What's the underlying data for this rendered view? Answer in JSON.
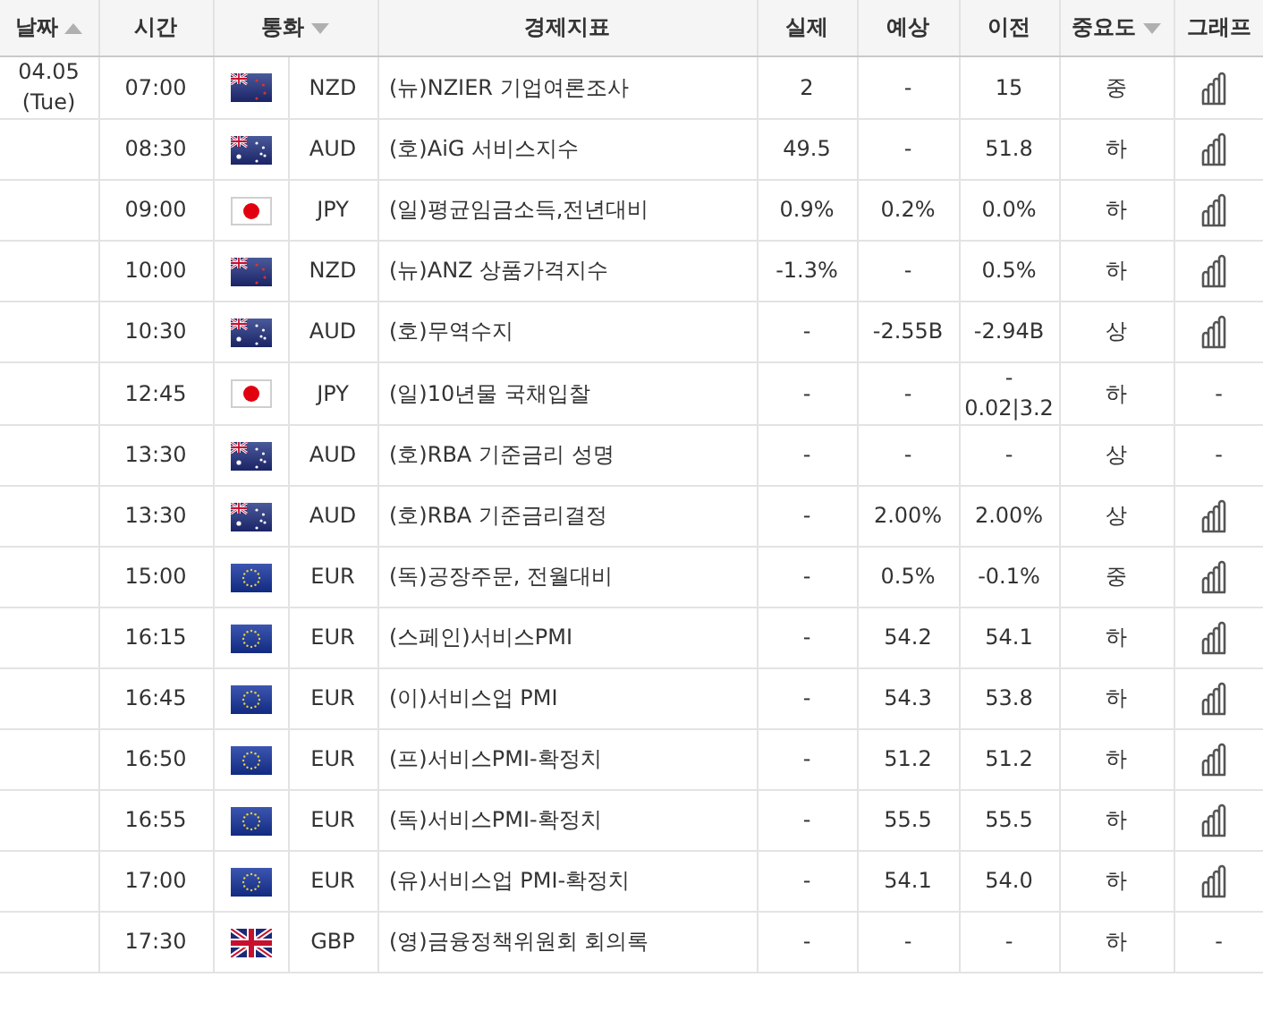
{
  "columns": [
    {
      "label": "날짜",
      "kind": "sort_asc"
    },
    {
      "label": "시간",
      "kind": "plain"
    },
    {
      "label": "통화",
      "kind": "sort_desc"
    },
    {
      "label": "경제지표",
      "kind": "plain"
    },
    {
      "label": "실제",
      "kind": "plain"
    },
    {
      "label": "예상",
      "kind": "plain"
    },
    {
      "label": "이전",
      "kind": "plain"
    },
    {
      "label": "중요도",
      "kind": "sort_desc"
    },
    {
      "label": "그래프",
      "kind": "plain"
    }
  ],
  "rows": [
    {
      "date": "04.05",
      "weekday": "(Tue)",
      "time": "07:00",
      "flag": {
        "kind": "nz"
      },
      "currency": "NZD",
      "indicator": "(뉴)NZIER 기업여론조사",
      "actual": "2",
      "forecast": "-",
      "previous": "15",
      "importance": "중",
      "graph": {
        "kind": "chart"
      }
    },
    {
      "time": "08:30",
      "flag": {
        "kind": "au"
      },
      "currency": "AUD",
      "indicator": "(호)AiG 서비스지수",
      "actual": "49.5",
      "forecast": "-",
      "previous": "51.8",
      "importance": "하",
      "graph": {
        "kind": "chart"
      }
    },
    {
      "time": "09:00",
      "flag": {
        "kind": "jp"
      },
      "currency": "JPY",
      "indicator": "(일)평균임금소득,전년대비",
      "actual": "0.9%",
      "forecast": "0.2%",
      "previous": "0.0%",
      "importance": "하",
      "graph": {
        "kind": "chart"
      }
    },
    {
      "time": "10:00",
      "flag": {
        "kind": "nz"
      },
      "currency": "NZD",
      "indicator": "(뉴)ANZ 상품가격지수",
      "actual": "-1.3%",
      "forecast": "-",
      "previous": "0.5%",
      "importance": "하",
      "graph": {
        "kind": "chart"
      }
    },
    {
      "time": "10:30",
      "flag": {
        "kind": "au"
      },
      "currency": "AUD",
      "indicator": "(호)무역수지",
      "actual": "-",
      "forecast": "-2.55B",
      "previous": "-2.94B",
      "importance": "상",
      "graph": {
        "kind": "chart"
      }
    },
    {
      "time": "12:45",
      "flag": {
        "kind": "jp"
      },
      "currency": "JPY",
      "indicator": "(일)10년물 국채입찰",
      "actual": "-",
      "forecast": "-",
      "previous": "-\n0.02|3.2",
      "importance": "하",
      "graph": {
        "kind": "text",
        "text": "-"
      }
    },
    {
      "time": "13:30",
      "flag": {
        "kind": "au"
      },
      "currency": "AUD",
      "indicator": "(호)RBA 기준금리 성명",
      "actual": "-",
      "forecast": "-",
      "previous": "-",
      "importance": "상",
      "graph": {
        "kind": "text",
        "text": "-"
      }
    },
    {
      "time": "13:30",
      "flag": {
        "kind": "au"
      },
      "currency": "AUD",
      "indicator": "(호)RBA 기준금리결정",
      "actual": "-",
      "forecast": "2.00%",
      "previous": "2.00%",
      "importance": "상",
      "graph": {
        "kind": "chart"
      }
    },
    {
      "time": "15:00",
      "flag": {
        "kind": "eu"
      },
      "currency": "EUR",
      "indicator": "(독)공장주문, 전월대비",
      "actual": "-",
      "forecast": "0.5%",
      "previous": "-0.1%",
      "importance": "중",
      "graph": {
        "kind": "chart"
      }
    },
    {
      "time": "16:15",
      "flag": {
        "kind": "eu"
      },
      "currency": "EUR",
      "indicator": "(스페인)서비스PMI",
      "actual": "-",
      "forecast": "54.2",
      "previous": "54.1",
      "importance": "하",
      "graph": {
        "kind": "chart"
      }
    },
    {
      "time": "16:45",
      "flag": {
        "kind": "eu"
      },
      "currency": "EUR",
      "indicator": "(이)서비스업 PMI",
      "actual": "-",
      "forecast": "54.3",
      "previous": "53.8",
      "importance": "하",
      "graph": {
        "kind": "chart"
      }
    },
    {
      "time": "16:50",
      "flag": {
        "kind": "eu"
      },
      "currency": "EUR",
      "indicator": "(프)서비스PMI-확정치",
      "actual": "-",
      "forecast": "51.2",
      "previous": "51.2",
      "importance": "하",
      "graph": {
        "kind": "chart"
      }
    },
    {
      "time": "16:55",
      "flag": {
        "kind": "eu"
      },
      "currency": "EUR",
      "indicator": "(독)서비스PMI-확정치",
      "actual": "-",
      "forecast": "55.5",
      "previous": "55.5",
      "importance": "하",
      "graph": {
        "kind": "chart"
      }
    },
    {
      "time": "17:00",
      "flag": {
        "kind": "eu"
      },
      "currency": "EUR",
      "indicator": "(유)서비스업 PMI-확정치",
      "actual": "-",
      "forecast": "54.1",
      "previous": "54.0",
      "importance": "하",
      "graph": {
        "kind": "chart"
      }
    },
    {
      "time": "17:30",
      "flag": {
        "kind": "gb"
      },
      "currency": "GBP",
      "indicator": "(영)금융정책위원회 회의록",
      "actual": "-",
      "forecast": "-",
      "previous": "-",
      "importance": "하",
      "graph": {
        "kind": "text",
        "text": "-"
      }
    }
  ]
}
